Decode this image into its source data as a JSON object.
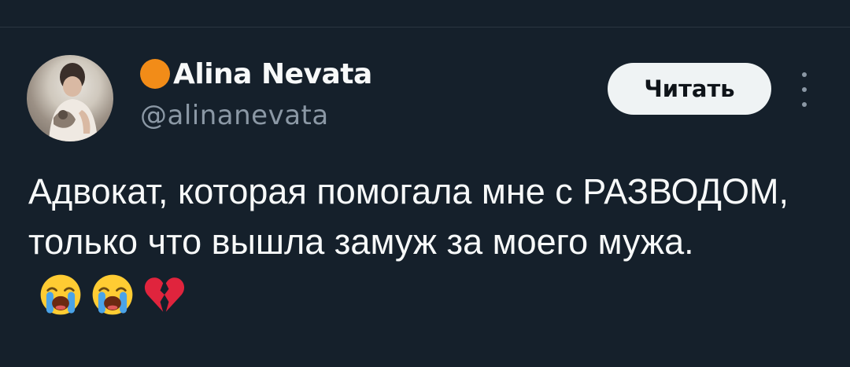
{
  "user": {
    "display_name": "Alina Nevata",
    "handle": "@alinanevata",
    "status_emoji": "orange-circle-icon"
  },
  "actions": {
    "follow_label": "Читать",
    "more_icon": "more-vertical-icon"
  },
  "tweet": {
    "text": "Адвокат, которая помогала мне с РАЗВОДОМ, только что вышла замуж за моего мужа.",
    "emojis": [
      "loudly-crying-face-icon",
      "loudly-crying-face-icon",
      "broken-heart-icon"
    ]
  },
  "colors": {
    "background": "#15202b",
    "text_primary": "#f7f9f9",
    "text_secondary": "#8b98a5",
    "follow_bg": "#eff3f4",
    "status_dot": "#f28c18",
    "broken_heart": "#e0243d"
  }
}
